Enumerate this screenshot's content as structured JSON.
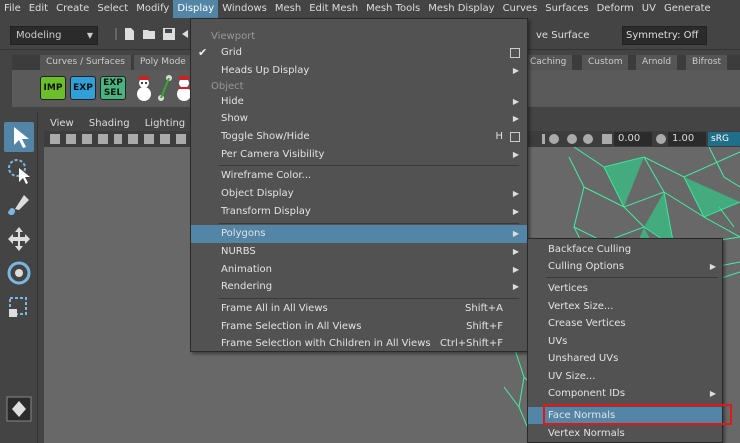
{
  "menubar": [
    "File",
    "Edit",
    "Create",
    "Select",
    "Modify",
    "Display",
    "Windows",
    "Mesh",
    "Edit Mesh",
    "Mesh Tools",
    "Mesh Display",
    "Curves",
    "Surfaces",
    "Deform",
    "UV",
    "Generate"
  ],
  "toolbar": {
    "mode": "Modeling",
    "live_surface": "ve Surface",
    "symmetry": "Symmetry: Off"
  },
  "shelf": {
    "tabs": [
      "Curves / Surfaces",
      "Poly Mode",
      "Caching",
      "Custom",
      "Arnold",
      "Bifrost"
    ],
    "buttons": [
      {
        "label": "IMP",
        "color": "#6abf2a"
      },
      {
        "label": "EXP",
        "color": "#2fa0d8"
      },
      {
        "label": "EXP\nSEL",
        "color": "#49b57e"
      }
    ]
  },
  "panel": {
    "menu": [
      "View",
      "Shading",
      "Lighting"
    ],
    "field1": "0.00",
    "field2": "1.00",
    "srgb": "sRG"
  },
  "display_menu": {
    "sections": {
      "viewport": "Viewport",
      "object": "Object"
    },
    "items": [
      {
        "label": "Grid",
        "checked": true,
        "checkbox": true
      },
      {
        "label": "Heads Up Display",
        "submenu": true
      },
      {
        "label": "Hide",
        "submenu": true
      },
      {
        "label": "Show",
        "submenu": true
      },
      {
        "label": "Toggle Show/Hide",
        "shortcut": "H",
        "checkbox": true
      },
      {
        "label": "Per Camera Visibility",
        "submenu": true
      },
      {
        "label": "Wireframe Color..."
      },
      {
        "label": "Object Display",
        "submenu": true
      },
      {
        "label": "Transform Display",
        "submenu": true
      },
      {
        "label": "Polygons",
        "submenu": true,
        "highlighted": true
      },
      {
        "label": "NURBS",
        "submenu": true
      },
      {
        "label": "Animation",
        "submenu": true
      },
      {
        "label": "Rendering",
        "submenu": true
      },
      {
        "label": "Frame All in All Views",
        "shortcut": "Shift+A"
      },
      {
        "label": "Frame Selection in All Views",
        "shortcut": "Shift+F"
      },
      {
        "label": "Frame Selection with Children in All Views",
        "shortcut": "Ctrl+Shift+F"
      }
    ]
  },
  "polygons_submenu": {
    "items": [
      {
        "label": "Backface Culling"
      },
      {
        "label": "Culling Options",
        "submenu": true
      },
      {
        "label": "Vertices"
      },
      {
        "label": "Vertex Size..."
      },
      {
        "label": "Crease Vertices"
      },
      {
        "label": "UVs"
      },
      {
        "label": "Unshared UVs"
      },
      {
        "label": "UV Size..."
      },
      {
        "label": "Component IDs",
        "submenu": true
      },
      {
        "label": "Face Normals",
        "highlighted": true
      },
      {
        "label": "Vertex Normals"
      }
    ]
  },
  "colors": {
    "highlight": "#5285a6",
    "annotation": "#e01818",
    "wireframe": "#3ff0a0"
  }
}
